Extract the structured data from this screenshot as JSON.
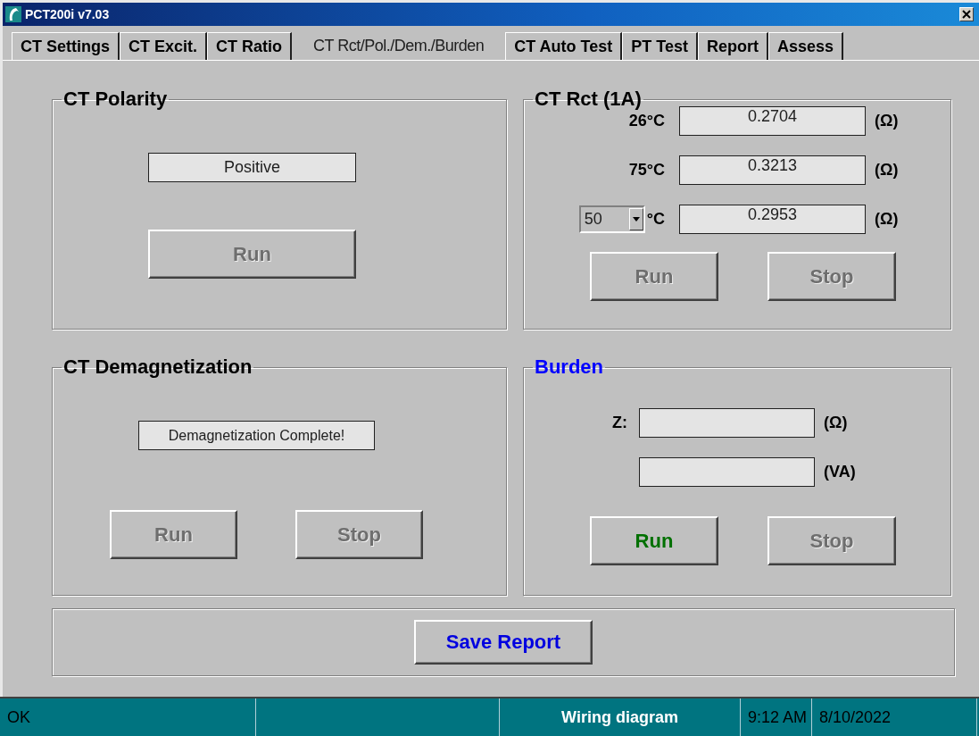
{
  "window": {
    "title": "PCT200i v7.03"
  },
  "tabs": [
    {
      "label": "CT Settings",
      "selected": false
    },
    {
      "label": "CT Excit.",
      "selected": false
    },
    {
      "label": "CT Ratio",
      "selected": false
    },
    {
      "label": "CT Rct/Pol./Dem./Burden",
      "selected": true
    },
    {
      "label": "CT Auto Test",
      "selected": false
    },
    {
      "label": "PT Test",
      "selected": false
    },
    {
      "label": "Report",
      "selected": false
    },
    {
      "label": "Assess",
      "selected": false
    }
  ],
  "groups": [
    {
      "kind": "result",
      "title": "CT Polarity",
      "color": "#000000",
      "result": "Positive",
      "buttons": [
        {
          "label": "Run",
          "disabled": true
        }
      ]
    },
    {
      "kind": "readings",
      "title": "CT Rct (1A)",
      "color": "#000000",
      "rows": [
        {
          "kind": "label",
          "temperature": "26°C",
          "value": "0.2704",
          "unit": "(Ω)"
        },
        {
          "kind": "label",
          "temperature": "75°C",
          "value": "0.3213",
          "unit": "(Ω)"
        },
        {
          "kind": "dropdown",
          "temperature": "50",
          "suffix": "°C",
          "value": "0.2953",
          "unit": "(Ω)"
        }
      ],
      "buttons": [
        {
          "label": "Run",
          "disabled": true
        },
        {
          "label": "Stop",
          "disabled": true
        }
      ]
    },
    {
      "kind": "result",
      "title": "CT Demagnetization",
      "color": "#000000",
      "result": "Demagnetization Complete!",
      "buttons": [
        {
          "label": "Run",
          "disabled": true
        },
        {
          "label": "Stop",
          "disabled": true
        }
      ]
    },
    {
      "kind": "readings",
      "title": "Burden",
      "color": "#0000ff",
      "rows": [
        {
          "kind": "label",
          "temperature": "Z:",
          "unit": "(Ω)"
        },
        {
          "kind": "blank",
          "unit": "(VA)"
        }
      ],
      "buttons": [
        {
          "label": "Run",
          "disabled": false
        },
        {
          "label": "Stop",
          "disabled": true
        }
      ]
    }
  ],
  "save_button": {
    "label": "Save Report"
  },
  "status_bar": {
    "message": "OK",
    "action": "Wiring diagram",
    "time": "9:12 AM",
    "date": "8/10/2022"
  }
}
